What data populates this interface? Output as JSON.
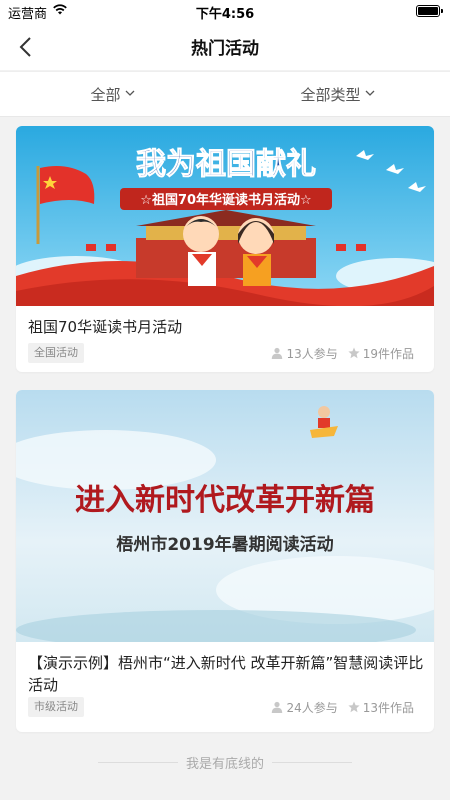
{
  "status_bar": {
    "carrier": "运营商",
    "time": "下午4:56"
  },
  "nav": {
    "title": "热门活动"
  },
  "filters": {
    "region": "全部",
    "type": "全部类型"
  },
  "activities": [
    {
      "banner": {
        "headline": "我为祖国献礼",
        "ribbon": "☆祖国70年华诞读书月活动☆"
      },
      "title": "祖国70华诞读书月活动",
      "tag": "全国活动",
      "participants": "13人参与",
      "works": "19件作品"
    },
    {
      "banner": {
        "headline": "进入新时代改革开新篇",
        "subline": "梧州市2019年暑期阅读活动"
      },
      "title": "【演示示例】梧州市“进入新时代 改革开新篇”智慧阅读评比活动",
      "tag": "市级活动",
      "participants": "24人参与",
      "works": "13件作品"
    }
  ],
  "footer": {
    "end_text": "我是有底线的"
  },
  "colors": {
    "banner1_sky": "#3db7e6",
    "banner1_red": "#e23a2a",
    "banner2_sky": "#cfe6f3",
    "banner2_text": "#b0191e"
  }
}
